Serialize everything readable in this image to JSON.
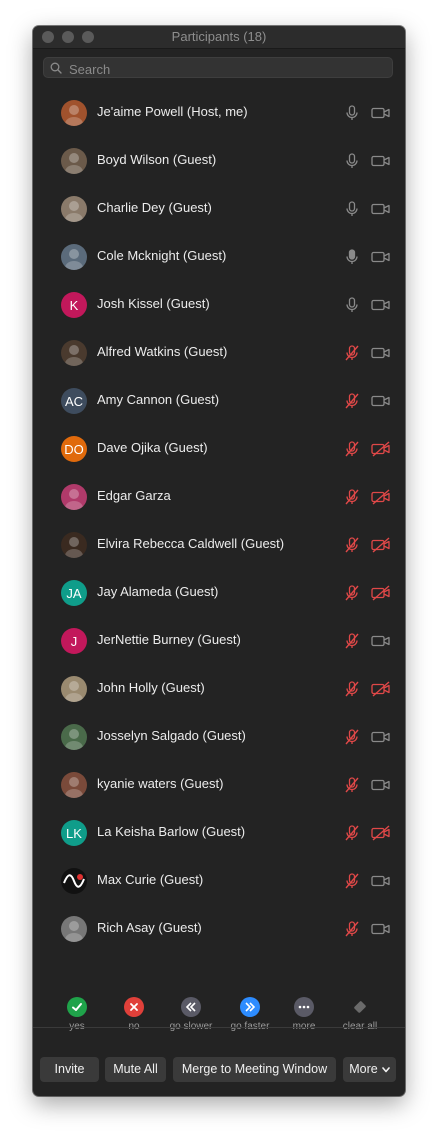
{
  "window": {
    "title": "Participants (18)"
  },
  "search": {
    "placeholder": "Search"
  },
  "participants": [
    {
      "name": "Je'aime Powell (Host, me)",
      "avatar": {
        "type": "photo",
        "color": "#a0522d"
      },
      "mic": "on",
      "video": "on"
    },
    {
      "name": "Boyd Wilson (Guest)",
      "avatar": {
        "type": "photo",
        "color": "#6b5a4a"
      },
      "mic": "on",
      "video": "on"
    },
    {
      "name": "Charlie Dey (Guest)",
      "avatar": {
        "type": "photo",
        "color": "#8a7a6a"
      },
      "mic": "on",
      "video": "on"
    },
    {
      "name": "Cole Mcknight (Guest)",
      "avatar": {
        "type": "photo",
        "color": "#5b6b7b"
      },
      "mic": "active",
      "video": "on"
    },
    {
      "name": "Josh Kissel (Guest)",
      "avatar": {
        "type": "initials",
        "initials": "K",
        "color": "#c2185b"
      },
      "mic": "on",
      "video": "on"
    },
    {
      "name": "Alfred Watkins (Guest)",
      "avatar": {
        "type": "photo",
        "color": "#4a3a2e"
      },
      "mic": "muted",
      "video": "on"
    },
    {
      "name": "Amy Cannon (Guest)",
      "avatar": {
        "type": "initials",
        "initials": "AC",
        "color": "#3e4c5e"
      },
      "mic": "muted",
      "video": "on"
    },
    {
      "name": "Dave Ojika (Guest)",
      "avatar": {
        "type": "initials",
        "initials": "DO",
        "color": "#e06a0c"
      },
      "mic": "muted",
      "video": "off"
    },
    {
      "name": "Edgar Garza",
      "avatar": {
        "type": "photo",
        "color": "#b03a6a"
      },
      "mic": "muted",
      "video": "off"
    },
    {
      "name": "Elvira Rebecca Caldwell (Guest)",
      "avatar": {
        "type": "photo",
        "color": "#3a2a20"
      },
      "mic": "muted",
      "video": "off"
    },
    {
      "name": "Jay Alameda (Guest)",
      "avatar": {
        "type": "initials",
        "initials": "JA",
        "color": "#0f9d8a"
      },
      "mic": "muted",
      "video": "off"
    },
    {
      "name": "JerNettie Burney (Guest)",
      "avatar": {
        "type": "initials",
        "initials": "J",
        "color": "#c2185b"
      },
      "mic": "muted",
      "video": "on"
    },
    {
      "name": "John Holly (Guest)",
      "avatar": {
        "type": "photo",
        "color": "#9a8a70"
      },
      "mic": "muted",
      "video": "off"
    },
    {
      "name": "Josselyn Salgado (Guest)",
      "avatar": {
        "type": "photo",
        "color": "#4a6a4a"
      },
      "mic": "muted",
      "video": "on"
    },
    {
      "name": "kyanie waters (Guest)",
      "avatar": {
        "type": "photo",
        "color": "#7a4a3a"
      },
      "mic": "muted",
      "video": "on"
    },
    {
      "name": "La Keisha Barlow (Guest)",
      "avatar": {
        "type": "initials",
        "initials": "LK",
        "color": "#0f9d8a"
      },
      "mic": "muted",
      "video": "off"
    },
    {
      "name": "Max Curie (Guest)",
      "avatar": {
        "type": "logo",
        "color": "#111111"
      },
      "mic": "muted",
      "video": "on"
    },
    {
      "name": "Rich Asay (Guest)",
      "avatar": {
        "type": "photo",
        "color": "#777777"
      },
      "mic": "muted",
      "video": "on"
    }
  ],
  "reactions": [
    {
      "label": "yes",
      "icon": "check-icon",
      "color": "#1fa34a"
    },
    {
      "label": "no",
      "icon": "x-icon",
      "color": "#e0403a"
    },
    {
      "label": "go slower",
      "icon": "rewind-icon",
      "color": "#5a5a66"
    },
    {
      "label": "go faster",
      "icon": "fast-forward-icon",
      "color": "#2d8cff"
    },
    {
      "label": "more",
      "icon": "ellipsis-icon",
      "color": "#5a5a66"
    },
    {
      "label": "clear all",
      "icon": "eraser-icon",
      "color": "#5a5a5a"
    }
  ],
  "buttons": {
    "invite": "Invite",
    "mute_all": "Mute All",
    "merge": "Merge to Meeting Window",
    "more": "More"
  },
  "colors": {
    "window_bg": "#232323",
    "muted_red": "#e04848",
    "icon_gray": "#8a8a8a"
  }
}
